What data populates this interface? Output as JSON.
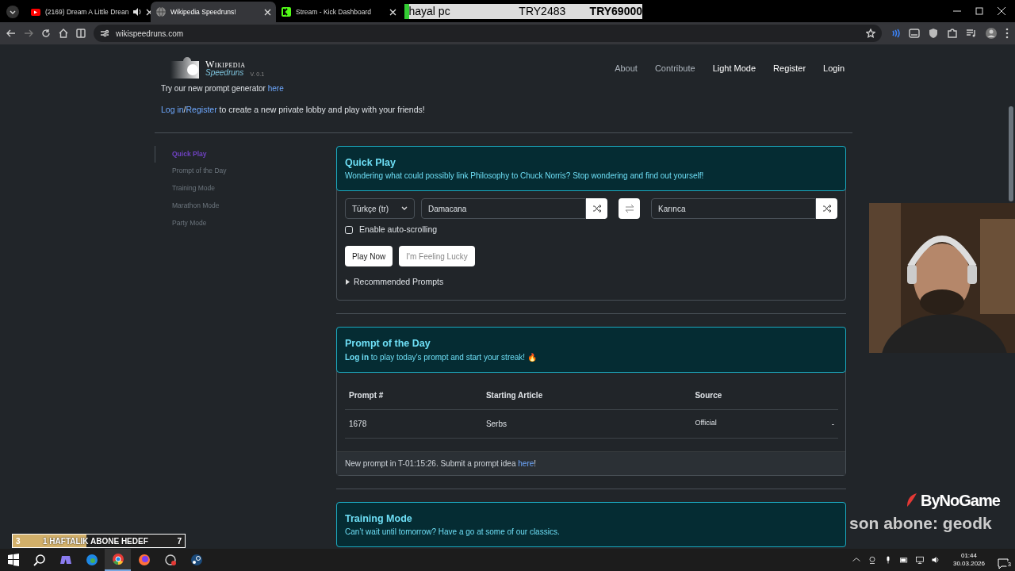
{
  "browser": {
    "tabs": [
      {
        "title": "(2169) Dream A Little Drean",
        "kind": "video",
        "audio": true,
        "selected": false
      },
      {
        "title": "Wikipedia Speedruns!",
        "kind": "globe",
        "audio": false,
        "selected": true
      },
      {
        "title": "Stream - Kick Dashboard",
        "kind": "kick",
        "audio": false,
        "selected": false
      }
    ],
    "address": "wikispeedruns.com"
  },
  "donation_overlay": {
    "name": "hayal pc",
    "amount": "TRY2483",
    "goal": "TRY69000"
  },
  "site": {
    "logo": {
      "title": "Wikipedia",
      "subtitle": "Speedruns",
      "version": "V. 0.1"
    },
    "nav": [
      {
        "label": "About",
        "emphasis": false
      },
      {
        "label": "Contribute",
        "emphasis": false
      },
      {
        "label": "Light Mode",
        "emphasis": true
      },
      {
        "label": "Register",
        "emphasis": true
      },
      {
        "label": "Login",
        "emphasis": true
      }
    ],
    "intro": {
      "text": "Try our new prompt generator ",
      "link": "here"
    },
    "lobby": {
      "login": "Log in",
      "sep": "/",
      "register": "Register",
      "text": " to create a new private lobby and play with your friends!"
    },
    "sidebar": [
      {
        "label": "Quick Play",
        "selected": true
      },
      {
        "label": "Prompt of the Day",
        "selected": false
      },
      {
        "label": "Training Mode",
        "selected": false
      },
      {
        "label": "Marathon Mode",
        "selected": false
      },
      {
        "label": "Party Mode",
        "selected": false
      }
    ],
    "quick_play": {
      "title": "Quick Play",
      "subtitle": "Wondering what could possibly link Philosophy to Chuck Norris? Stop wondering and find out yourself!",
      "language": "Türkçe (tr)",
      "start": "Damacana",
      "end": "Karınca",
      "autoscroll": {
        "label": "Enable auto-scrolling",
        "checked": false
      },
      "buttons": [
        "Play Now",
        "I'm Feeling Lucky"
      ],
      "recommended": {
        "label": "Recommended Prompts",
        "expanded": false
      }
    },
    "prompt_of_the_day": {
      "title": "Prompt of the Day",
      "subtitle": "**Log in** to play today’s prompt and start your streak! 🔥",
      "columns": [
        "Prompt #",
        "Starting Article",
        "Source"
      ],
      "rows": [
        [
          "1678",
          "Serbs",
          "Official",
          "-"
        ]
      ],
      "footer": "New prompt in T-01:15:26. Submit a prompt idea ",
      "footer_link": "here",
      "footer_end": "!"
    },
    "training": {
      "title": "Training Mode",
      "subtitle": "Can’t wait until tomorrow? Have a go at some of our classics."
    }
  },
  "stream_overlay": {
    "brand": "ByNoGame",
    "last_sub": "son abone: geodk",
    "goal": {
      "current": "3",
      "label": "1 HAFTALIK ABONE HEDEF",
      "target": "7",
      "level": 0.43
    }
  },
  "taskbar": {
    "time": "01:44",
    "date": "30.03.2026",
    "notifications": "3"
  }
}
